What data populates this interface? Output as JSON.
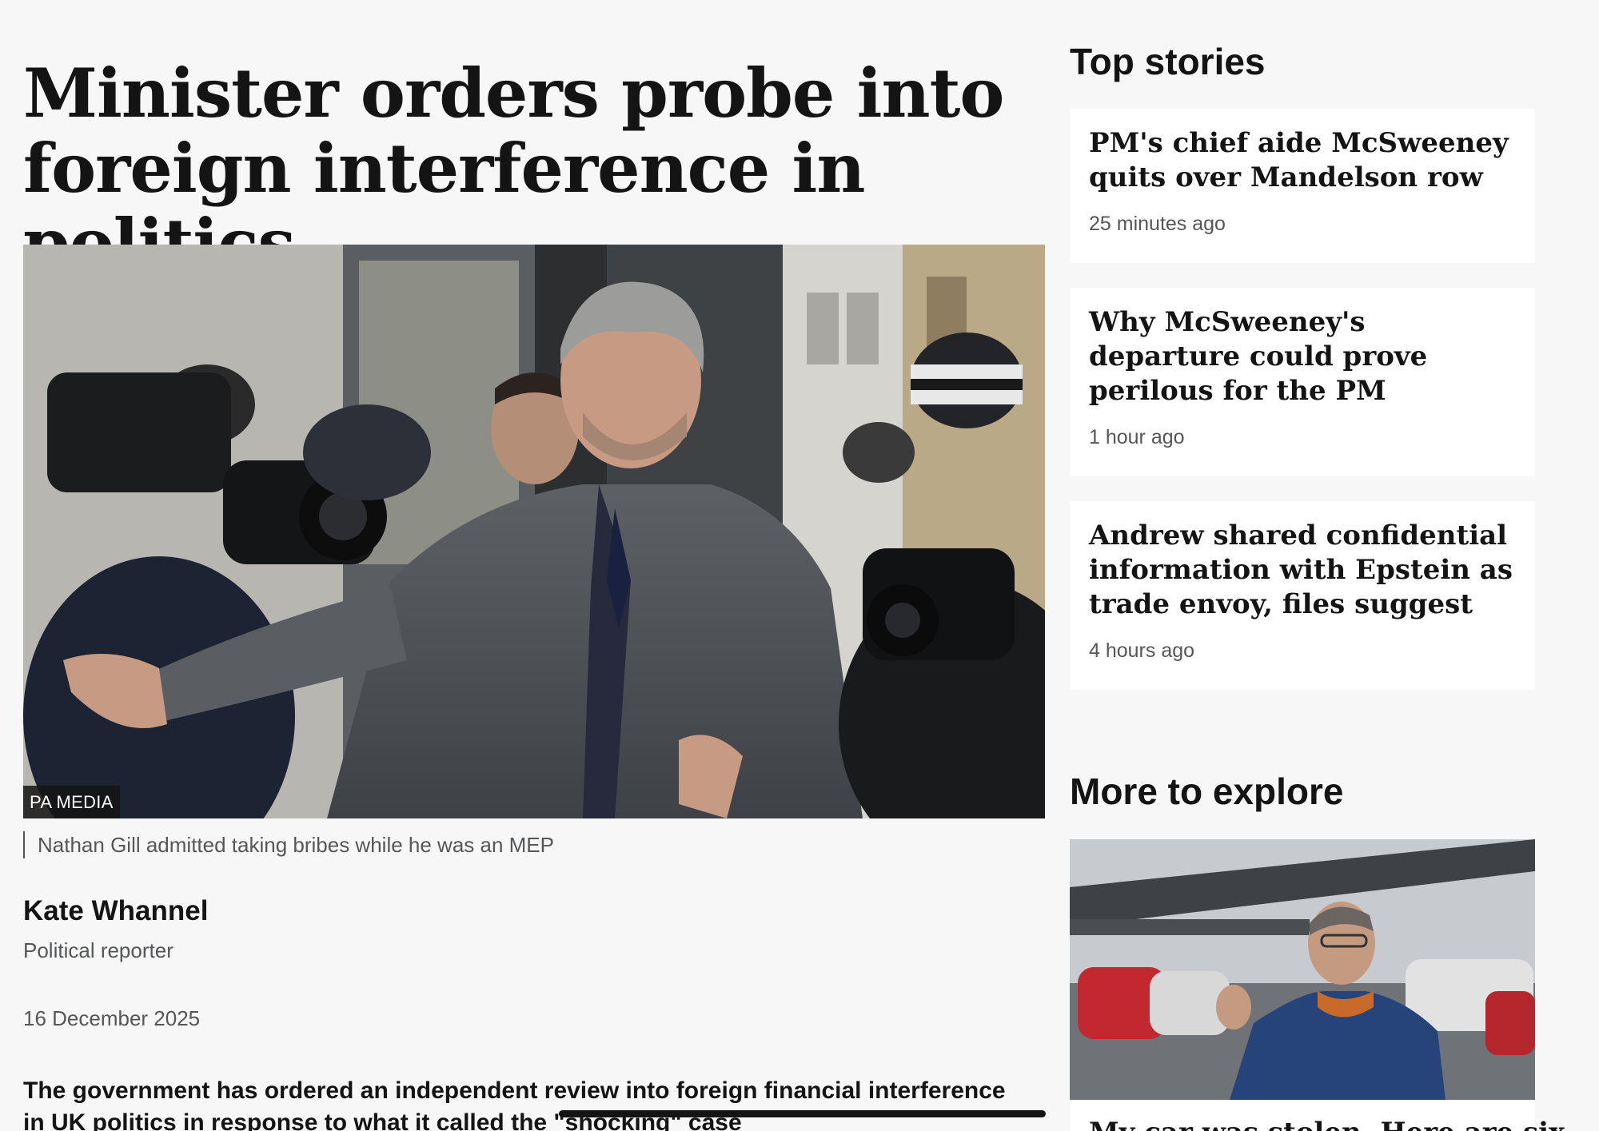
{
  "article": {
    "headline": "Minister orders probe into foreign interference in politics",
    "image_credit": "PA MEDIA",
    "image_caption": "Nathan Gill admitted taking bribes while he was an MEP",
    "author_name": "Kate Whannel",
    "author_role": "Political reporter",
    "date": "16 December 2025",
    "lede": "The government has ordered an independent review into foreign financial interference in UK politics in response to what it called the \"shocking\" case"
  },
  "sidebar": {
    "top_stories_title": "Top stories",
    "top_stories": [
      {
        "title": "PM's chief aide McSweeney quits over Mandelson row",
        "time": "25 minutes ago"
      },
      {
        "title": "Why McSweeney's departure could prove perilous for the PM",
        "time": "1 hour ago"
      },
      {
        "title": "Andrew shared confidential information with Epstein as trade envoy, files suggest",
        "time": "4 hours ago"
      }
    ],
    "more_to_explore_title": "More to explore",
    "explore_items": [
      {
        "title": "My car was stolen. Here are six"
      }
    ]
  },
  "icons": {
    "hero_image": "press-photo",
    "explore_image": "man-in-car-park-photo"
  },
  "colors": {
    "background": "#f7f7f7",
    "card": "#ffffff",
    "text": "#141414",
    "muted": "#545658"
  }
}
